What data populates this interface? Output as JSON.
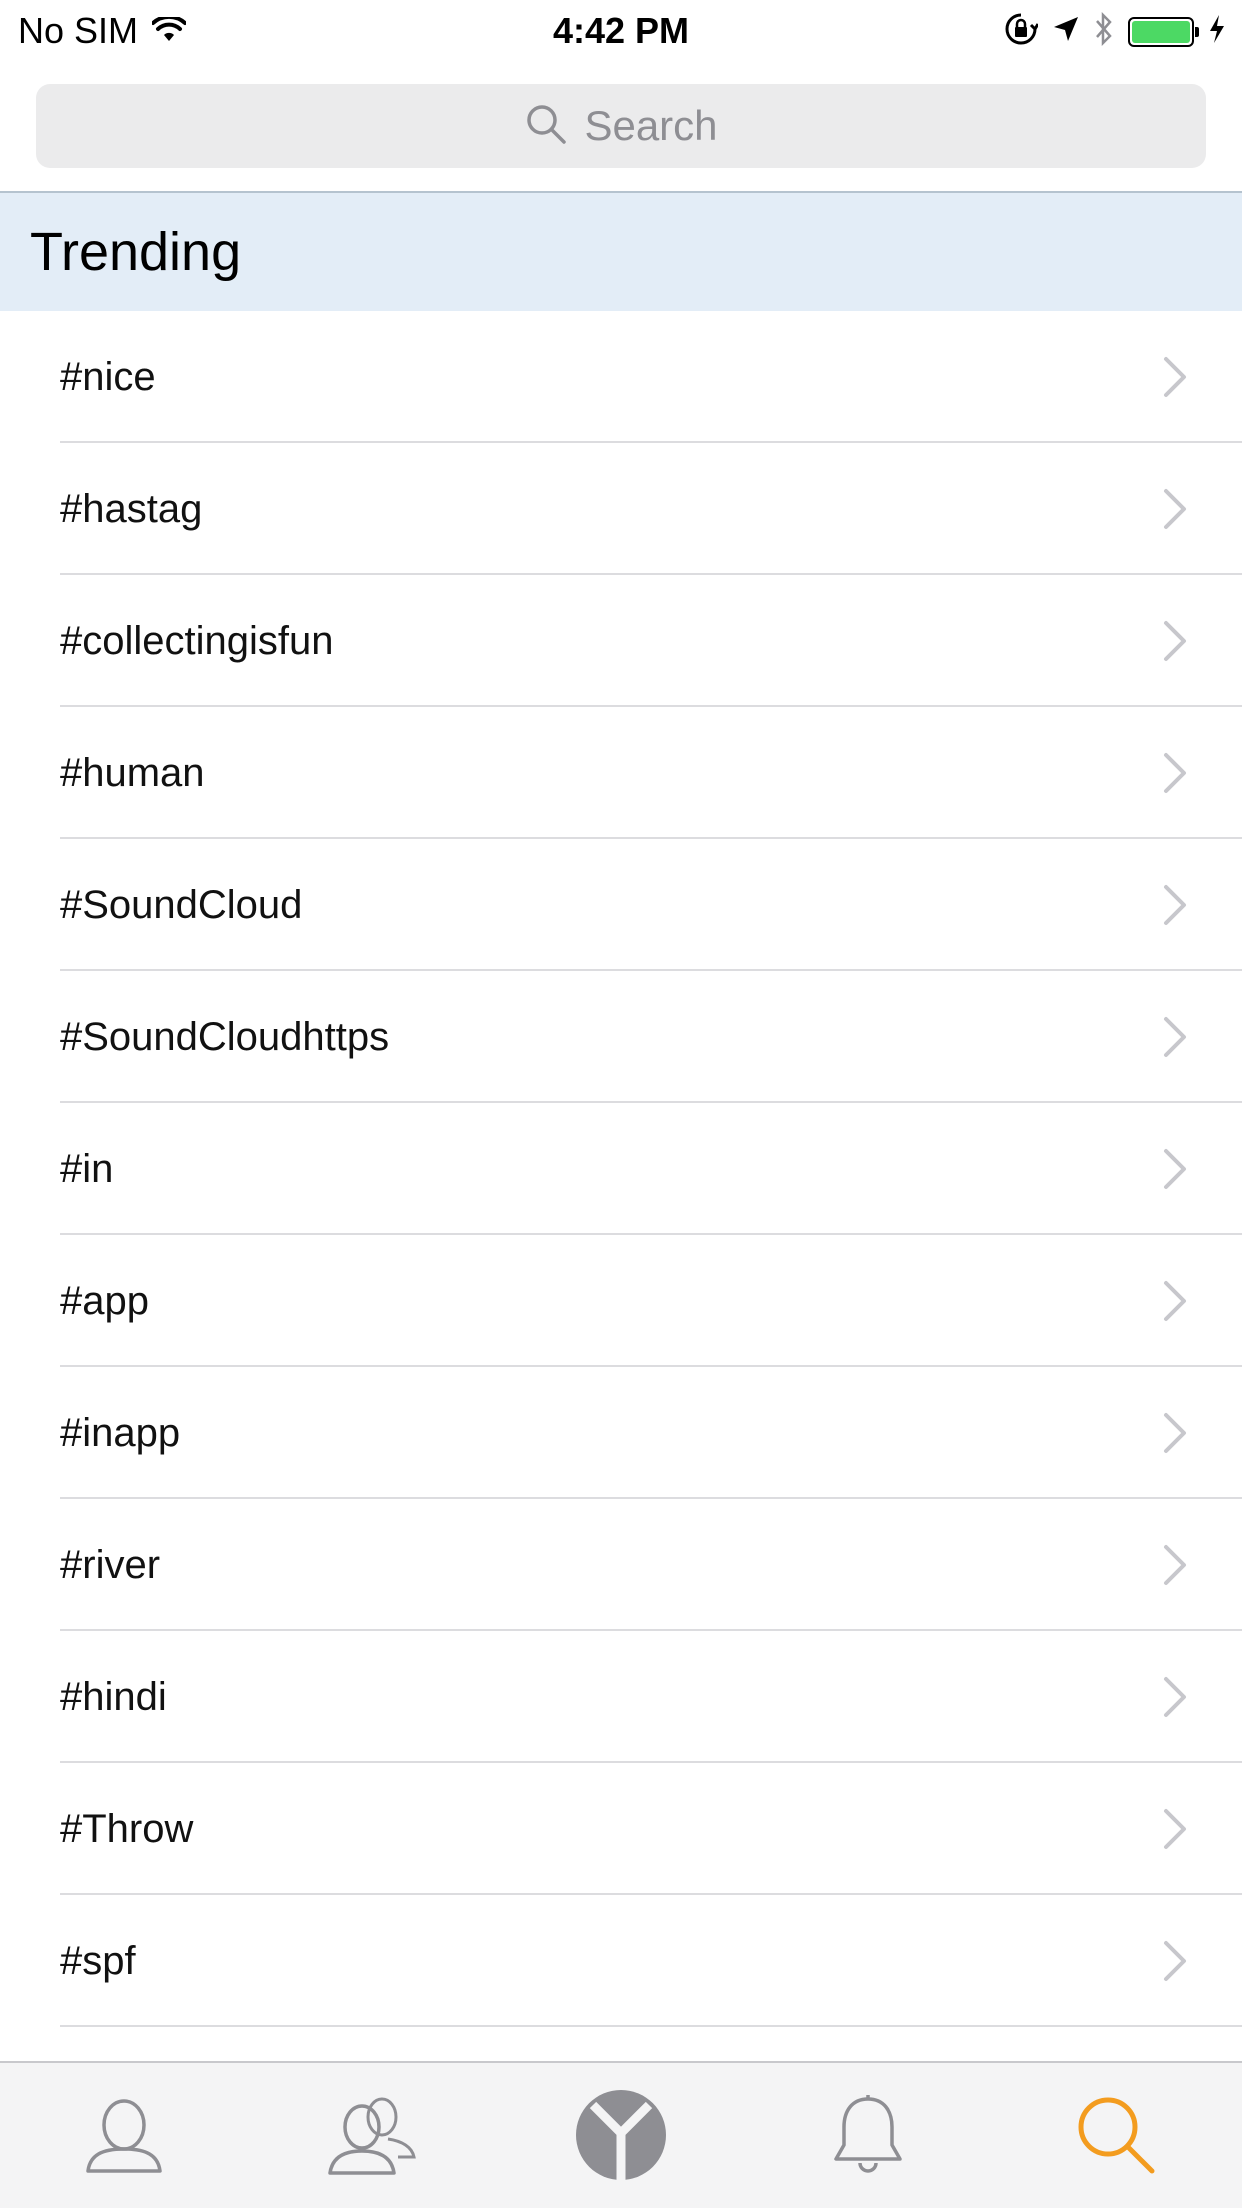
{
  "status_bar": {
    "carrier": "No SIM",
    "time": "4:42 PM",
    "battery_color": "#4cd964",
    "battery_level_percent": 100
  },
  "search": {
    "placeholder": "Search"
  },
  "section": {
    "title": "Trending"
  },
  "trending_items": [
    {
      "label": "#nice"
    },
    {
      "label": "#hastag"
    },
    {
      "label": "#collectingisfun"
    },
    {
      "label": "#human"
    },
    {
      "label": "#SoundCloud"
    },
    {
      "label": "#SoundCloudhttps"
    },
    {
      "label": "#in"
    },
    {
      "label": "#app"
    },
    {
      "label": "#inapp"
    },
    {
      "label": "#river"
    },
    {
      "label": "#hindi"
    },
    {
      "label": "#Throw"
    },
    {
      "label": "#spf"
    }
  ],
  "tab_bar": {
    "tabs": [
      {
        "icon": "profile-icon",
        "active": false
      },
      {
        "icon": "friends-icon",
        "active": false
      },
      {
        "icon": "app-logo-icon",
        "active": false
      },
      {
        "icon": "bell-icon",
        "active": false
      },
      {
        "icon": "search-icon",
        "active": true
      }
    ],
    "active_color": "#f39c1f",
    "inactive_color": "#8e8e93"
  },
  "colors": {
    "section_header_bg": "#e3edf7",
    "search_bg": "#ebebec"
  }
}
